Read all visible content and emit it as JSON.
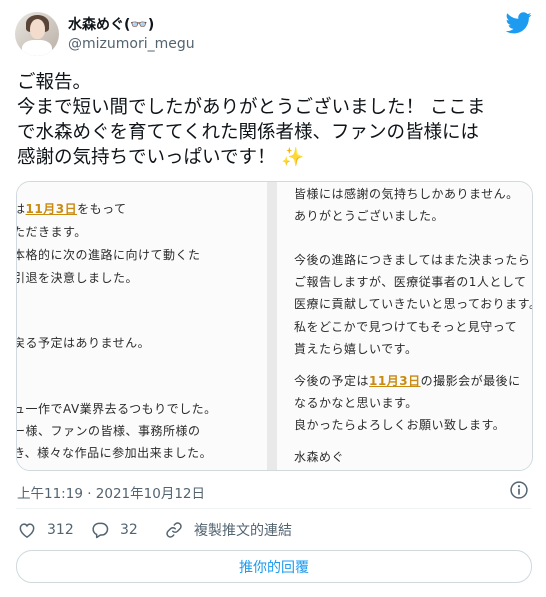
{
  "author": {
    "display_name": "水森めぐ(👓)",
    "handle": "@mizumori_megu"
  },
  "tweet": {
    "lines": [
      "ご報告。",
      "今まで短い間でしたがありがとうございました！ ここま",
      "で水森めぐを育ててくれた関係者様、ファンの皆様には",
      "感謝の気持ちでいっぱいです！ "
    ],
    "emoji": "✨"
  },
  "media": {
    "left_note": [
      {
        "pre": "は",
        "hl": "11月3日",
        "post": "をもって"
      },
      {
        "text": "ただきます。"
      },
      {
        "text": "本格的に次の進路に向けて動くた"
      },
      {
        "text": "引退を決意しました。"
      },
      {
        "text": "戻る予定はありません。"
      },
      {
        "text": "ュ一作でAV業界去るつもりでした。"
      },
      {
        "text": "ー様、ファンの皆様、事務所様の"
      },
      {
        "text": "き、様々な作品に参加出来ました。"
      }
    ],
    "right_note": [
      {
        "text": "皆様には感謝の気持ちしかありません。"
      },
      {
        "text": "ありがとうございました。"
      },
      {
        "text": "今後の進路につきましてはまた決まったら"
      },
      {
        "text": "ご報告しますが、医療従事者の1人として"
      },
      {
        "text": "医療に貢献していきたいと思っております。"
      },
      {
        "text": "私をどこかで見つけてもそっと見守って"
      },
      {
        "text": "貰えたら嬉しいです。"
      },
      {
        "pre": "今後の予定は",
        "hl": "11月3日",
        "post": "の撮影会が最後に"
      },
      {
        "text": "なるかなと思います。"
      },
      {
        "text": "良かったらよろしくお願い致します。"
      },
      {
        "text": "水森めぐ"
      }
    ]
  },
  "meta": {
    "timestamp": "上午11:19 · 2021年10月12日"
  },
  "actions": {
    "likes": "312",
    "replies": "32",
    "copy_link": "複製推文的連結"
  },
  "reply_button": "推你的回覆",
  "colors": {
    "brand_blue": "#1d9bf0",
    "highlight": "#c98b12",
    "muted": "#536471"
  },
  "icons": [
    "twitter-bird-icon",
    "info-icon",
    "heart-icon",
    "reply-icon",
    "link-icon"
  ]
}
